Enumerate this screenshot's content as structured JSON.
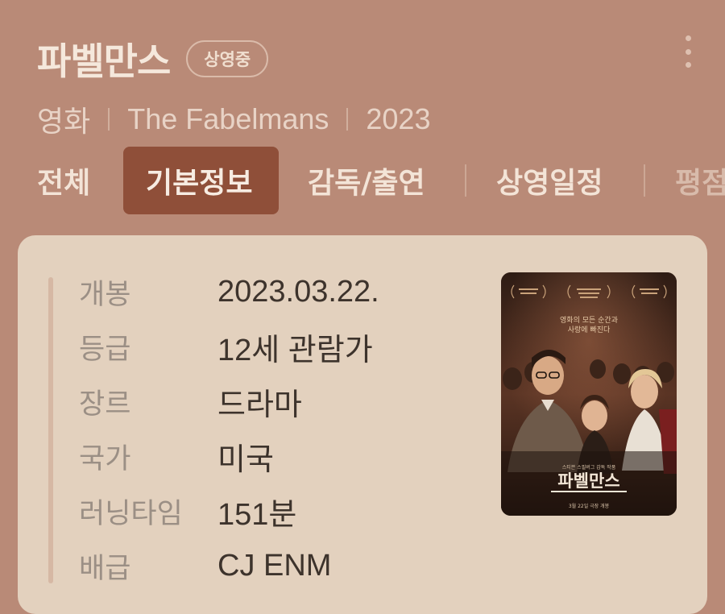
{
  "header": {
    "title": "파벨만스",
    "badge": "상영중",
    "category": "영화",
    "original_title": "The Fabelmans",
    "year": "2023"
  },
  "tabs": [
    {
      "label": "전체"
    },
    {
      "label": "기본정보",
      "active": true
    },
    {
      "label": "감독/출연"
    },
    {
      "label": "상영일정"
    },
    {
      "label": "평점"
    }
  ],
  "info": [
    {
      "label": "개봉",
      "value": "2023.03.22."
    },
    {
      "label": "등급",
      "value": "12세 관람가"
    },
    {
      "label": "장르",
      "value": "드라마"
    },
    {
      "label": "국가",
      "value": "미국"
    },
    {
      "label": "러닝타임",
      "value": "151분"
    },
    {
      "label": "배급",
      "value": "CJ ENM"
    }
  ],
  "poster": {
    "title": "파벨만스",
    "tagline_1": "영화의 모든 순간과",
    "tagline_2": "사랑에 빠진다",
    "credit": "스티븐 스필버그 감독 작품",
    "release_note": "3월 22일 극장 개봉"
  },
  "colors": {
    "background": "#b98a77",
    "active_tab": "#8f4f39",
    "card": "#e3d1be"
  }
}
